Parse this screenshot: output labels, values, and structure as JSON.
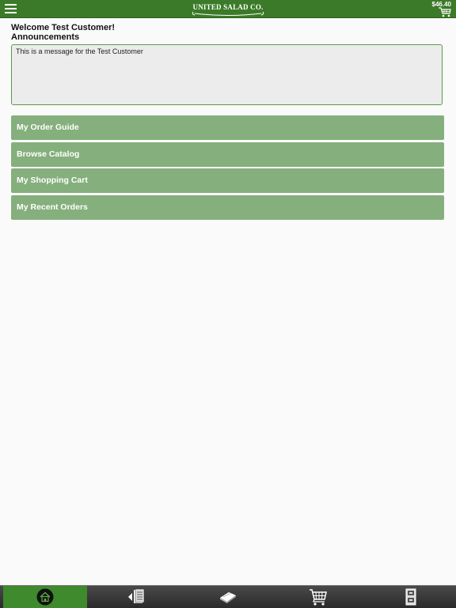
{
  "header": {
    "logo_text": "UNITED SALAD CO.",
    "cart_total": "$46.40"
  },
  "main": {
    "welcome": "Welcome Test Customer!",
    "announcements_title": "Announcements",
    "announcement_message": "This is a message for the Test Customer"
  },
  "nav": {
    "items": [
      {
        "label": "My Order Guide"
      },
      {
        "label": "Browse Catalog"
      },
      {
        "label": "My Shopping Cart"
      },
      {
        "label": "My Recent Orders"
      }
    ]
  },
  "tabbar": {
    "tabs": [
      {
        "icon": "home-icon",
        "active": true
      },
      {
        "icon": "order-guide-icon",
        "active": false
      },
      {
        "icon": "catalog-book-icon",
        "active": false
      },
      {
        "icon": "shopping-cart-icon",
        "active": false
      },
      {
        "icon": "recent-orders-icon",
        "active": false
      }
    ]
  },
  "colors": {
    "header_bg": "#3b7a28",
    "nav_button_bg": "#85af7c",
    "active_tab_bg": "#3f8a2c",
    "tabbar_bg": "#2f2f2f"
  }
}
